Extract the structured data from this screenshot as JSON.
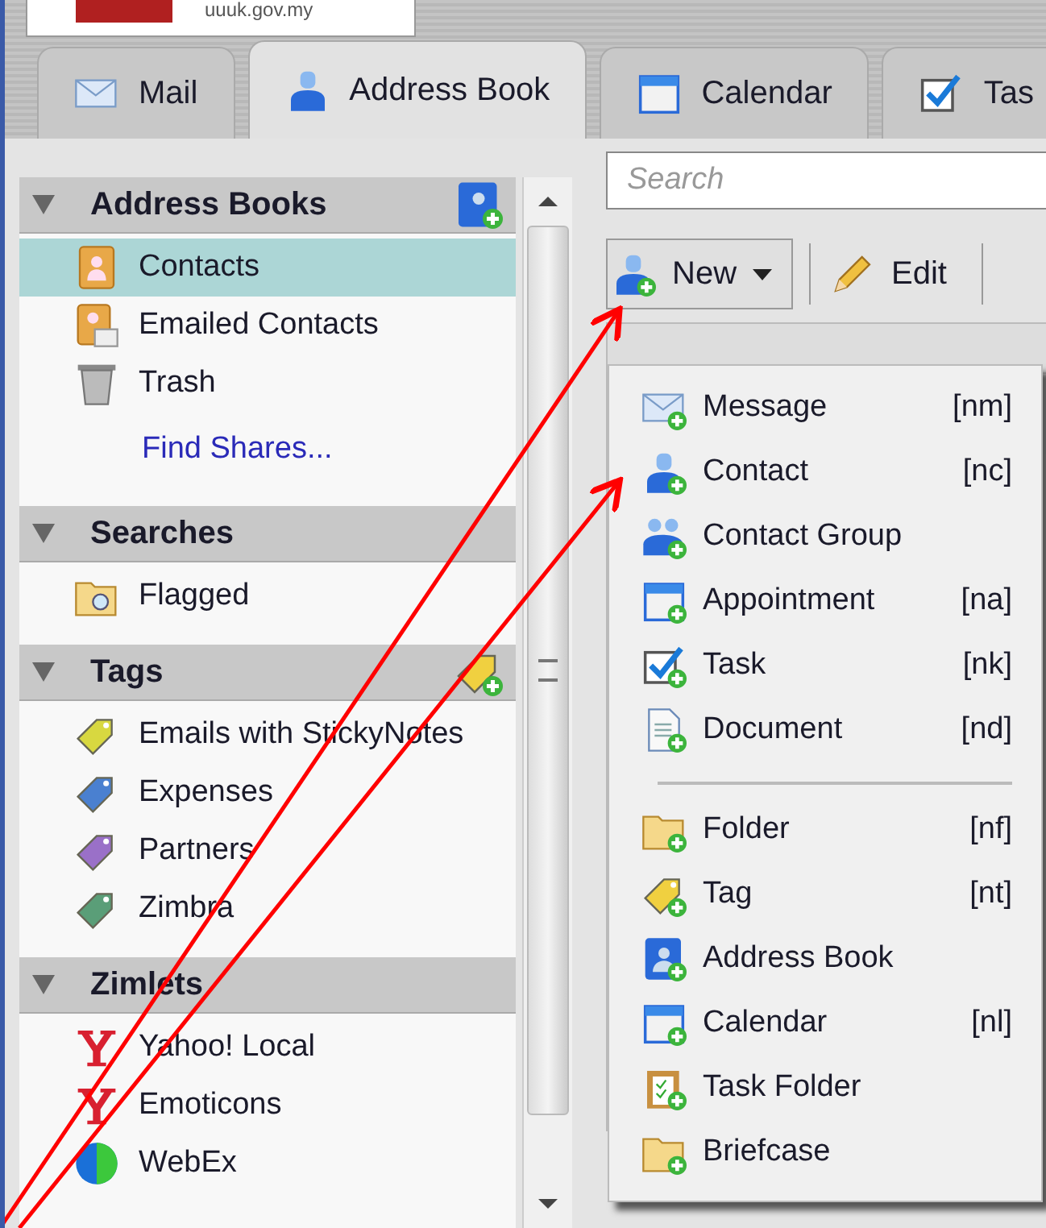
{
  "logo": {
    "text": "uuuk.gov.my"
  },
  "tabs": [
    {
      "label": "Mail",
      "kind": "mail",
      "selected": false
    },
    {
      "label": "Address Book",
      "kind": "person",
      "selected": true
    },
    {
      "label": "Calendar",
      "kind": "calendar",
      "selected": false
    },
    {
      "label": "Tas",
      "kind": "check",
      "selected": false
    }
  ],
  "sidebar": {
    "sections": [
      {
        "title": "Address Books",
        "expanded": true,
        "add_button": {
          "kind": "book"
        },
        "items": [
          {
            "label": "Contacts",
            "kind": "contacts",
            "selected": true
          },
          {
            "label": "Emailed Contacts",
            "kind": "emailed",
            "selected": false
          },
          {
            "label": "Trash",
            "kind": "trash",
            "selected": false
          },
          {
            "label": "Find Shares...",
            "kind": "link",
            "selected": false
          }
        ]
      },
      {
        "title": "Searches",
        "expanded": true,
        "items": [
          {
            "label": "Flagged",
            "kind": "search",
            "selected": false
          }
        ]
      },
      {
        "title": "Tags",
        "expanded": true,
        "add_button": {
          "kind": "tag"
        },
        "items": [
          {
            "label": "Emails with StickyNotes",
            "kind": "tag",
            "color": "#d8d840",
            "selected": false
          },
          {
            "label": "Expenses",
            "kind": "tag",
            "color": "#4a80d0",
            "selected": false
          },
          {
            "label": "Partners",
            "kind": "tag",
            "color": "#9a70c8",
            "selected": false
          },
          {
            "label": "Zimbra",
            "kind": "tag",
            "color": "#5a9e78",
            "selected": false
          }
        ]
      },
      {
        "title": "Zimlets",
        "expanded": true,
        "items": [
          {
            "label": "Yahoo! Local",
            "kind": "yahoo",
            "selected": false
          },
          {
            "label": "Emoticons",
            "kind": "yahoo",
            "selected": false
          },
          {
            "label": "WebEx",
            "kind": "globe",
            "selected": false
          }
        ]
      }
    ]
  },
  "search": {
    "placeholder": "Search"
  },
  "toolbar": {
    "new_button": "New",
    "edit_button": "Edit"
  },
  "menu": {
    "groups": [
      [
        {
          "label": "Message",
          "shortcut": "[nm]",
          "kind": "mail"
        },
        {
          "label": "Contact",
          "shortcut": "[nc]",
          "kind": "person"
        },
        {
          "label": "Contact Group",
          "kind": "people"
        },
        {
          "label": "Appointment",
          "shortcut": "[na]",
          "kind": "calendar"
        },
        {
          "label": "Task",
          "shortcut": "[nk]",
          "kind": "check"
        },
        {
          "label": "Document",
          "shortcut": "[nd]",
          "kind": "doc"
        }
      ],
      [
        {
          "label": "Folder",
          "shortcut": "[nf]",
          "kind": "folder"
        },
        {
          "label": "Tag",
          "shortcut": "[nt]",
          "kind": "tag"
        },
        {
          "label": "Address Book",
          "kind": "book"
        },
        {
          "label": "Calendar",
          "shortcut": "[nl]",
          "kind": "calendar"
        },
        {
          "label": "Task Folder",
          "kind": "clipboard"
        },
        {
          "label": "Briefcase",
          "kind": "folder"
        }
      ]
    ]
  }
}
